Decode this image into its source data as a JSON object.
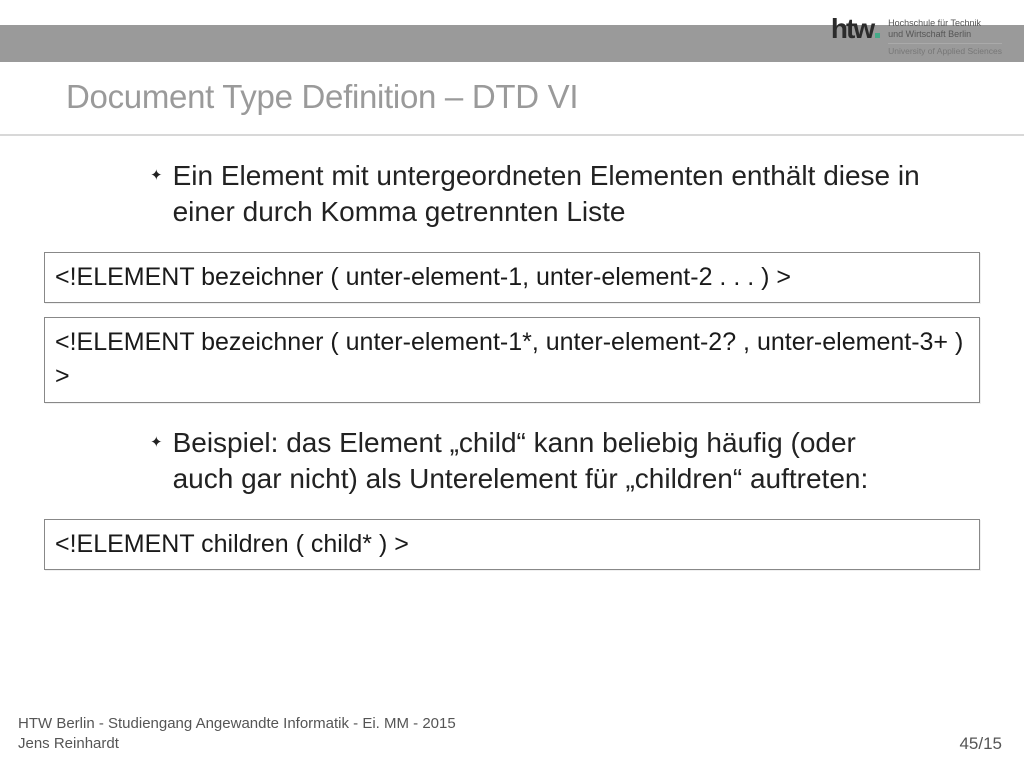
{
  "logo": {
    "wordmark": "htw",
    "line1": "Hochschule für Technik",
    "line2": "und Wirtschaft Berlin",
    "sub": "University of Applied Sciences"
  },
  "title": "Document Type Definition – DTD VI",
  "bullets": {
    "b1": "Ein Element mit untergeordneten Elementen enthält diese in einer durch Komma getrennten Liste",
    "b2": "Beispiel: das Element „child“ kann beliebig häufig (oder auch gar nicht) als Unterelement für „children“ auftreten:"
  },
  "code": {
    "c1": "<!ELEMENT bezeichner ( unter-element-1, unter-element-2 . . . ) >",
    "c2": "<!ELEMENT bezeichner ( unter-element-1*, unter-element-2? , unter-element-3+ ) >",
    "c3": "<!ELEMENT children ( child* ) >"
  },
  "footer": {
    "line1": "HTW Berlin - Studiengang Angewandte Informatik - Ei. MM - 2015",
    "line2": "Jens Reinhardt",
    "page": "45/15"
  }
}
